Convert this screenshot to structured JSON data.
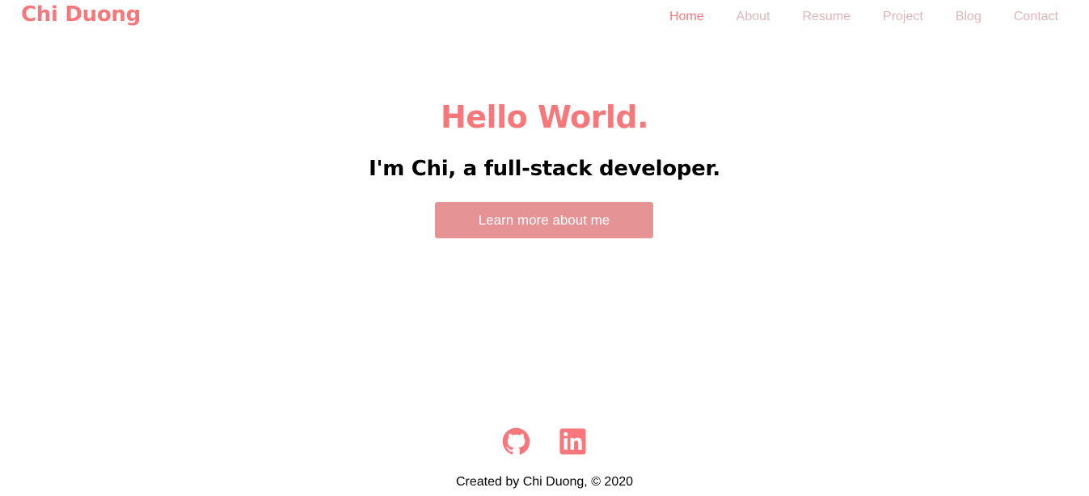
{
  "header": {
    "brand": "Chi Duong",
    "nav": [
      {
        "label": "Home",
        "active": true
      },
      {
        "label": "About",
        "active": false
      },
      {
        "label": "Resume",
        "active": false
      },
      {
        "label": "Project",
        "active": false
      },
      {
        "label": "Blog",
        "active": false
      },
      {
        "label": "Contact",
        "active": false
      }
    ]
  },
  "hero": {
    "title": "Hello World.",
    "subtitle": "I'm Chi, a full-stack developer.",
    "cta_label": "Learn more about me"
  },
  "footer": {
    "socials": [
      {
        "icon": "github-icon"
      },
      {
        "icon": "linkedin-icon"
      }
    ],
    "credit": "Created by Chi Duong, © 2020"
  },
  "colors": {
    "accent": "#f7777a",
    "nav_inactive": "#e0b5b8",
    "button_bg": "#e59395",
    "text": "#000000",
    "background": "#ffffff"
  }
}
